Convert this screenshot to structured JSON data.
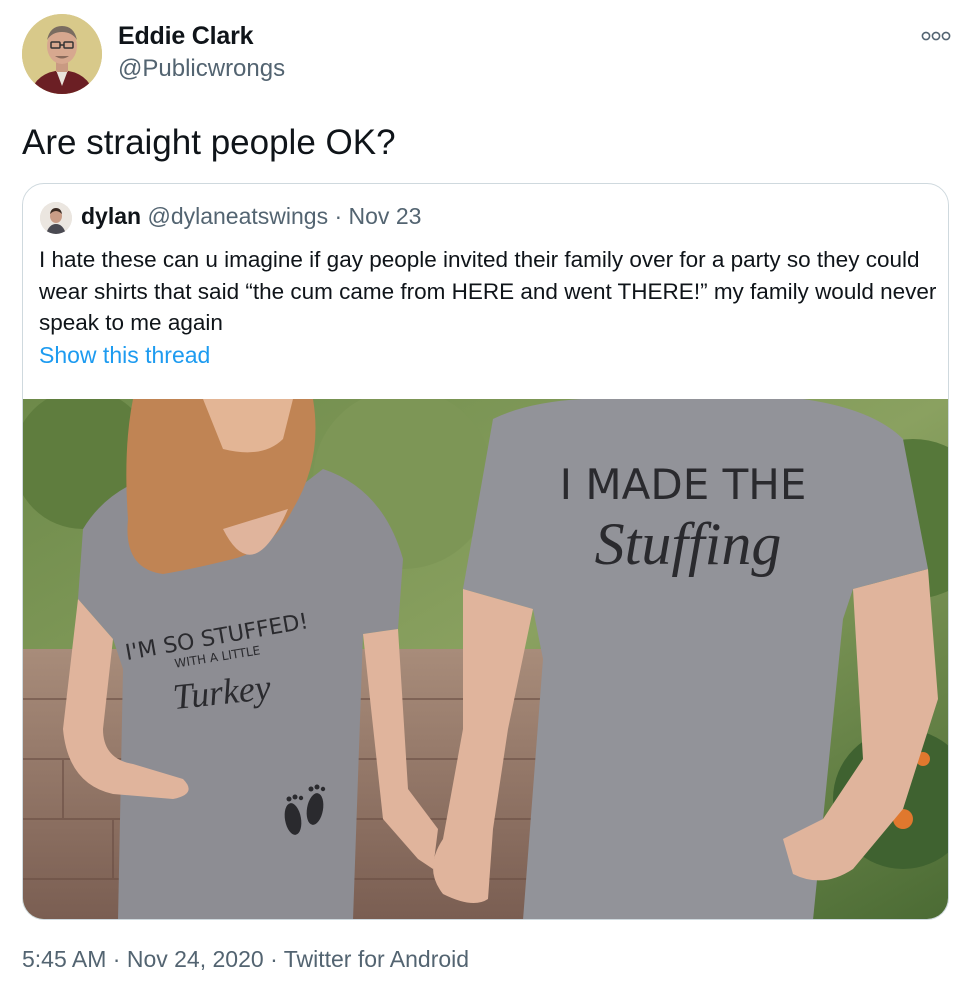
{
  "author": {
    "display_name": "Eddie Clark",
    "handle": "@Publicwrongs",
    "avatar_icon": "avatar-man-glasses-icon"
  },
  "tweet": {
    "text": "Are straight people OK?"
  },
  "more_icon": "more-options-icon",
  "quoted": {
    "display_name": "dylan",
    "handle": "@dylaneatswings",
    "separator": "·",
    "date": "Nov 23",
    "text": "I hate these can u imagine if gay people invited their family over for a party so they could wear shirts that said “the cum came from HERE and went THERE!” my family would never speak to me again",
    "show_thread_label": "Show this thread",
    "image": {
      "shirt_left_line1": "I'M SO STUFFED!",
      "shirt_left_line2": "WITH A LITTLE",
      "shirt_left_line3": "Turkey",
      "shirt_right_line1": "I MADE THE",
      "shirt_right_line2": "Stuffing"
    }
  },
  "footer": {
    "time": "5:45 AM",
    "separator": "·",
    "date": "Nov 24, 2020",
    "source": "Twitter for Android"
  },
  "colors": {
    "link": "#1d9bf0",
    "secondary_text": "#536471",
    "border": "#cfd9de"
  }
}
